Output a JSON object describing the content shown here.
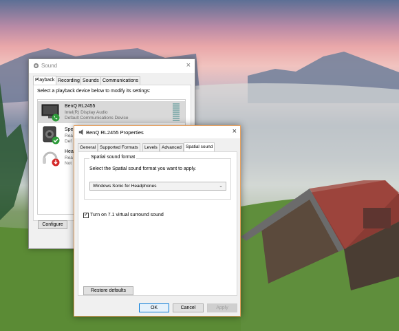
{
  "sound_window": {
    "title": "Sound",
    "close_symbol": "×",
    "tabs": [
      {
        "label": "Playback",
        "active": true
      },
      {
        "label": "Recording",
        "active": false
      },
      {
        "label": "Sounds",
        "active": false
      },
      {
        "label": "Communications",
        "active": false
      }
    ],
    "instruction": "Select a playback device below to modify its settings:",
    "devices": [
      {
        "name": "BenQ RL2455",
        "line1": "Intel(R) Display Audio",
        "line2": "Default Communications Device",
        "icon": "monitor-icon",
        "status_icon": "phone-default-icon",
        "selected": true
      },
      {
        "name": "Spe",
        "line1": "Rea",
        "line2": "Def",
        "icon": "speaker-icon",
        "status_icon": "checkmark-default-icon",
        "selected": false
      },
      {
        "name": "Hea",
        "line1": "Rea",
        "line2": "Not",
        "icon": "headphones-icon",
        "status_icon": "unplugged-icon",
        "selected": false
      }
    ],
    "configure_label": "Configure"
  },
  "properties_window": {
    "title": "BenQ RL2455 Properties",
    "close_symbol": "×",
    "tabs": [
      {
        "label": "General",
        "active": false
      },
      {
        "label": "Supported Formats",
        "active": false
      },
      {
        "label": "Levels",
        "active": false
      },
      {
        "label": "Advanced",
        "active": false
      },
      {
        "label": "Spatial sound",
        "active": true
      }
    ],
    "group_title": "Spatial sound format",
    "group_description": "Select the Spatial sound format you want to apply.",
    "format_selected": "Windows Sonic for Headphones",
    "virtual_surround_label": "Turn on 7.1 virtual surround sound",
    "virtual_surround_checked": true,
    "check_mark": "✓",
    "restore_label": "Restore defaults",
    "ok_label": "OK",
    "cancel_label": "Cancel",
    "apply_label": "Apply",
    "apply_enabled": false
  },
  "colors": {
    "accent": "#0078d7",
    "active_border": "#e8a15e",
    "selection": "#d9d9d9",
    "status_green": "#2e9b3a",
    "status_red": "#d42a2a"
  }
}
